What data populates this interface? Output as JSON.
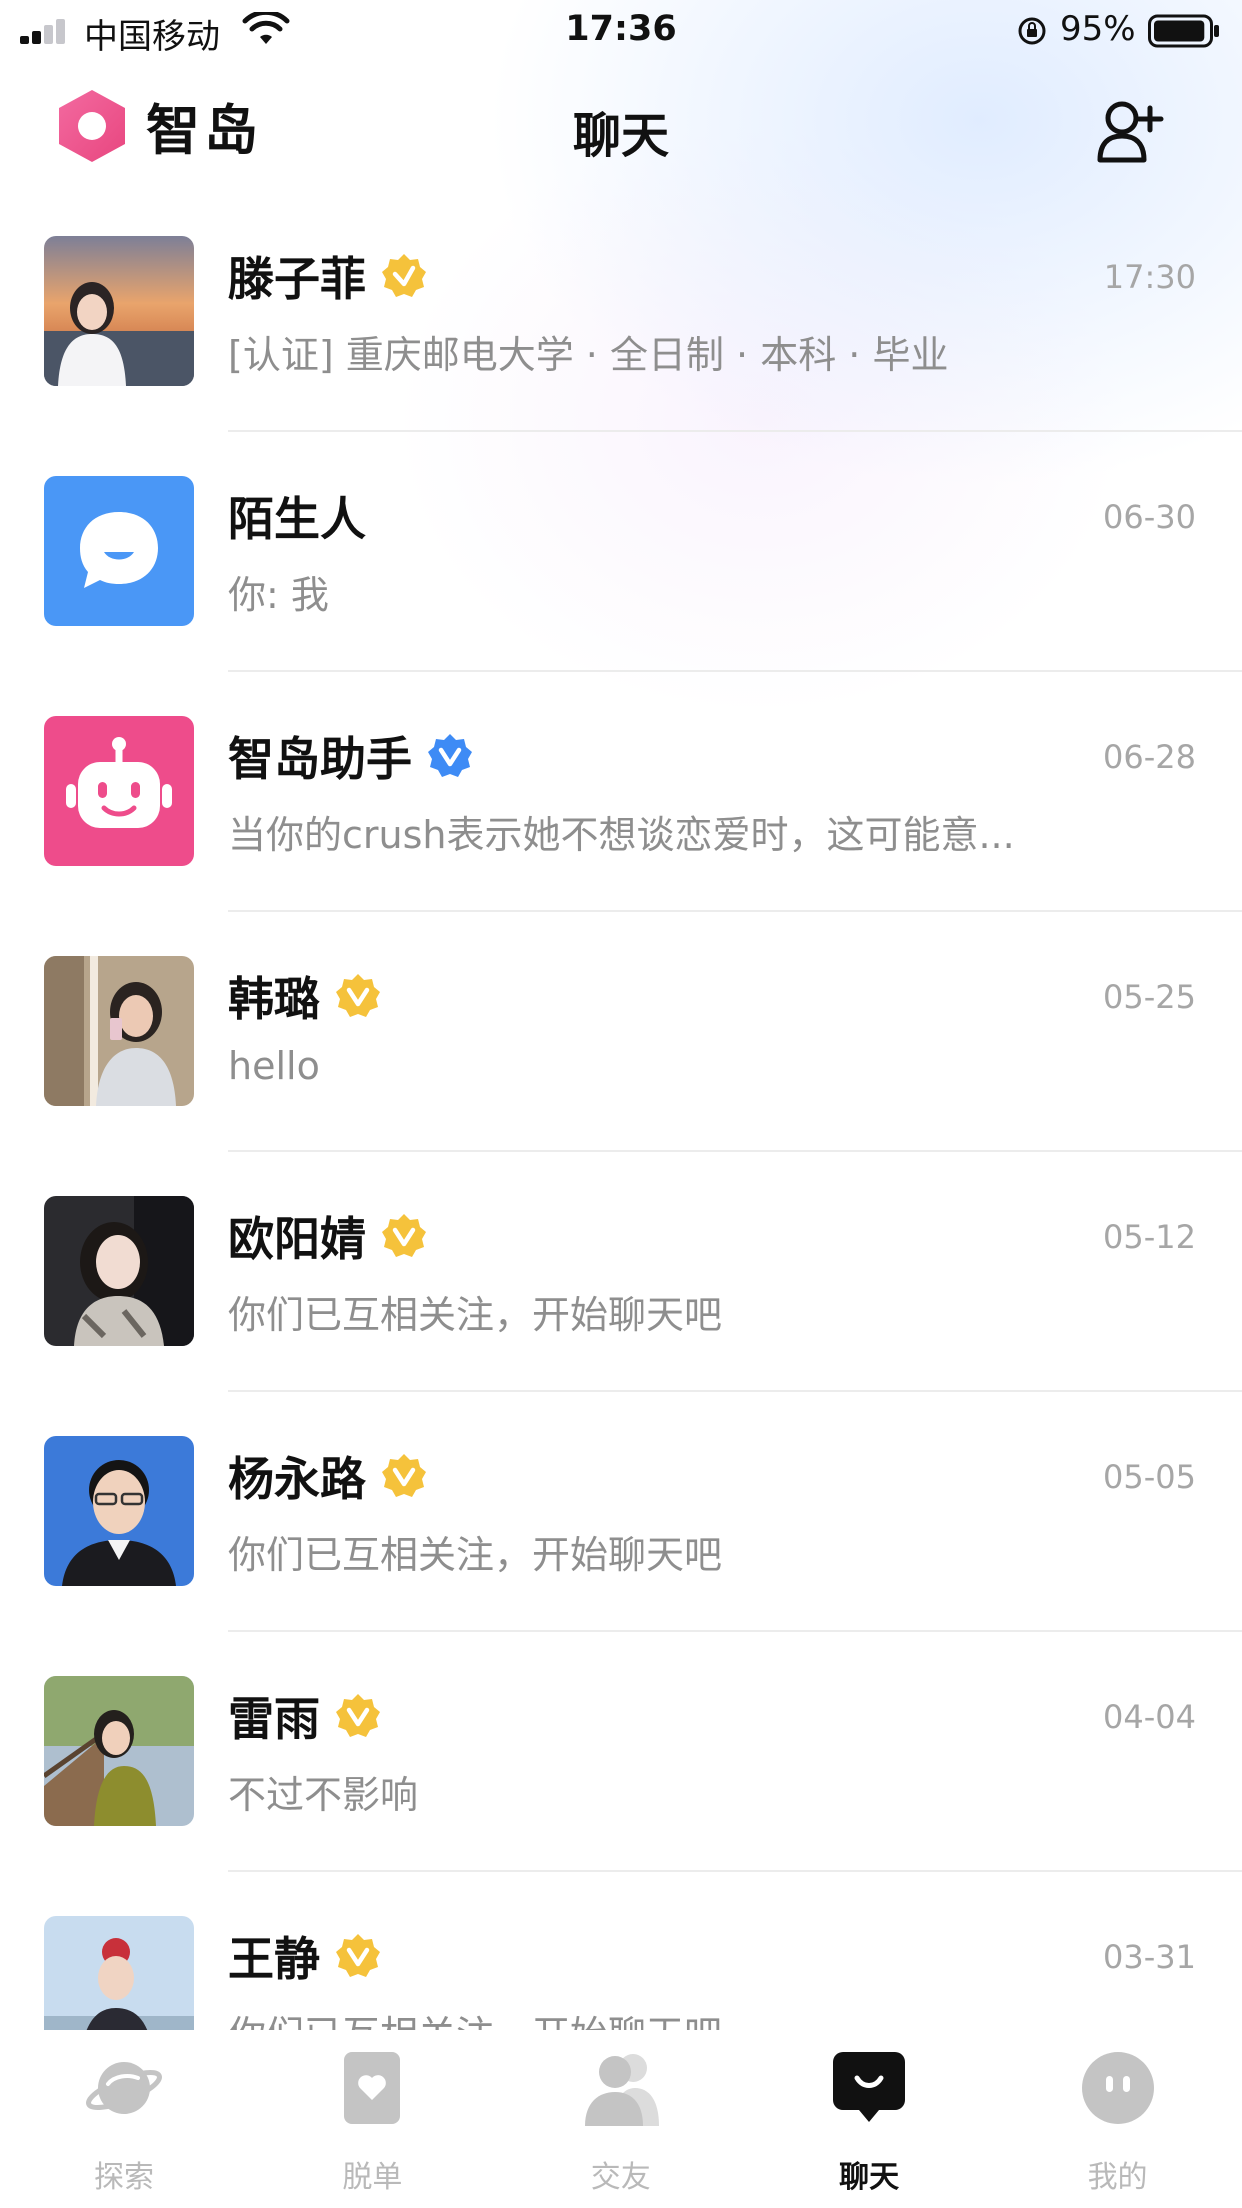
{
  "status_bar": {
    "carrier": "中国移动",
    "time": "17:36",
    "battery": "95%",
    "battery_level": 0.95,
    "signal_bars": 2
  },
  "header": {
    "app_name": "智岛",
    "title": "聊天",
    "add_friend_icon": "add-friend-icon"
  },
  "colors": {
    "verified_gold": "#F5C23B",
    "verified_blue": "#3E8BF5",
    "stranger_blue": "#4A97F6",
    "assistant_pink": "#EE4C8B",
    "logo_pink": "#EF4F8E"
  },
  "chats": [
    {
      "name": "滕子菲",
      "time": "17:30",
      "preview": "[认证] 重庆邮电大学 · 全日制 · 本科 · 毕业",
      "badge": "gold"
    },
    {
      "name": "陌生人",
      "time": "06-30",
      "preview": "你: 我",
      "badge": "none"
    },
    {
      "name": "智岛助手",
      "time": "06-28",
      "preview": "当你的crush表示她不想谈恋爱时，这可能意...",
      "badge": "blue"
    },
    {
      "name": "韩璐",
      "time": "05-25",
      "preview": "hello",
      "badge": "gold"
    },
    {
      "name": "欧阳婧",
      "time": "05-12",
      "preview": "你们已互相关注，开始聊天吧",
      "badge": "gold"
    },
    {
      "name": "杨永路",
      "time": "05-05",
      "preview": "你们已互相关注，开始聊天吧",
      "badge": "gold"
    },
    {
      "name": "雷雨",
      "time": "04-04",
      "preview": "不过不影响",
      "badge": "gold"
    },
    {
      "name": "王静",
      "time": "03-31",
      "preview": "你们已互相关注，开始聊天吧",
      "badge": "gold"
    }
  ],
  "tabs": [
    {
      "label": "探索",
      "icon": "planet-icon",
      "active": false
    },
    {
      "label": "脱单",
      "icon": "heart-card-icon",
      "active": false
    },
    {
      "label": "交友",
      "icon": "people-icon",
      "active": false
    },
    {
      "label": "聊天",
      "icon": "chat-bubble-icon",
      "active": true
    },
    {
      "label": "我的",
      "icon": "profile-face-icon",
      "active": false
    }
  ]
}
